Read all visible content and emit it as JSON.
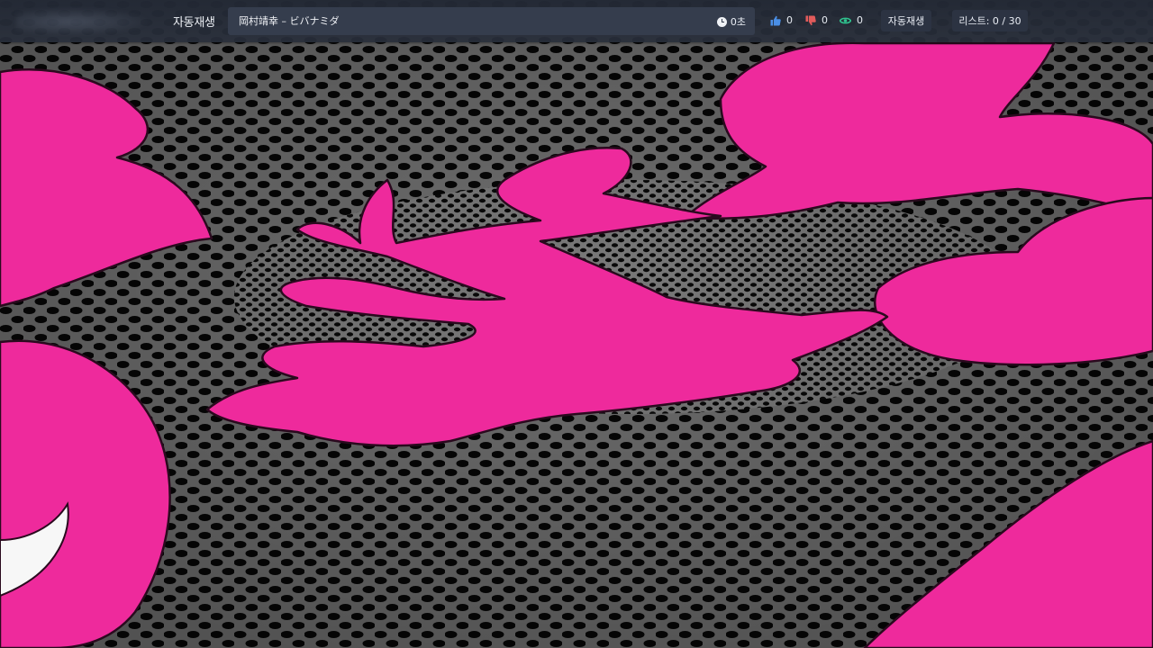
{
  "header": {
    "autoplay_title": "자동재생",
    "now_playing": {
      "song_title": "岡村靖幸 – ビバナミダ",
      "elapsed": "0초"
    },
    "likes": "0",
    "dislikes": "0",
    "views": "0",
    "autoplay_button": "자동재생",
    "list_counter": "리스트: 0 / 30"
  },
  "colors": {
    "header_bg": "#262c38",
    "panel_bg": "#353d4d",
    "like_blue": "#4a8fe6",
    "dislike_red": "#e25b5b",
    "views_green": "#2fc48f",
    "video_pink": "#ee2a9c",
    "video_gray": "#6f6f6f"
  },
  "icons": [
    "clock-icon",
    "thumbs-up-icon",
    "thumbs-down-icon",
    "eye-icon"
  ]
}
